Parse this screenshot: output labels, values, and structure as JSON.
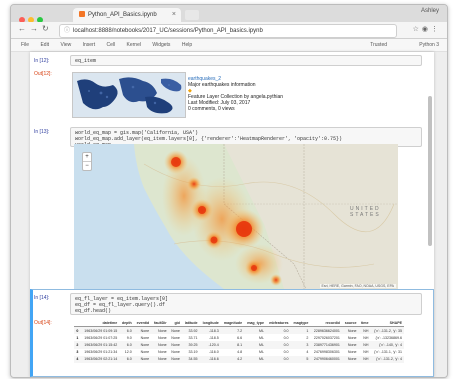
{
  "window": {
    "tab_title": "Python_API_Basics.ipynb",
    "profile_label": "Ashley"
  },
  "address_bar": {
    "url": "localhost:8888/notebooks/2017_UC/sessions/Python_API_basics.ipynb"
  },
  "notebook_menu": {
    "items": [
      "File",
      "Edit",
      "View",
      "Insert",
      "Cell",
      "Kernel",
      "Widgets",
      "Help"
    ],
    "kernel_status": "Trusted",
    "kernel_name": "Python 3"
  },
  "cells": {
    "cell1": {
      "in_prompt": "In [12]:",
      "code": "eq_item",
      "out_prompt": "Out[12]:",
      "item_title": "earthquakes_2",
      "item_desc": "Major earthquakes information",
      "item_type": "Feature Layer Collection by angela.pythian",
      "item_modified": "Last Modified: July 03, 2017",
      "item_comments": "0 comments, 0 views"
    },
    "cell2": {
      "in_prompt": "In [13]:",
      "code_lines": [
        "world_eq_map = gis.map('California, USA')",
        "world_eq_map.add_layer(eq_item.layers[0], {'renderer':'HeatmapRenderer', 'opacity':0.75})",
        "world_eq_map"
      ],
      "map_country_label_1": "UNITED",
      "map_country_label_2": "STATES",
      "map_attribution": "Esri, HERE, Garmin, FAO, NOAA, USGS, EPA"
    },
    "cell3": {
      "in_prompt": "In [14]:",
      "code_lines": [
        "eq_fl_layer = eq_item.layers[0]",
        "eq_df = eq_fl_layer.query().df",
        "eq_df.head()"
      ],
      "out_prompt": "Out[14]:"
    }
  },
  "table": {
    "columns": [
      "",
      "datetime",
      "depth",
      "eventid",
      "faultDir",
      "gid",
      "latitude",
      "longitude",
      "magnitude",
      "mag_type",
      "mbfeatures",
      "magtype",
      "recordid",
      "source",
      "time",
      "SHAPE"
    ],
    "rows": [
      [
        "0",
        "1963/06/29 01:09:15",
        "6.0",
        "None",
        "None",
        "None",
        "33.92",
        "-118.3",
        "7.2",
        "ML",
        "0.0",
        "1",
        "2289636624001",
        "None",
        "NH",
        "{'x': -131.2, 'y': 35"
      ],
      [
        "1",
        "1963/06/29 01:07:25",
        "9.0",
        "None",
        "None",
        "None",
        "33.71",
        "-118.5",
        "6.6",
        "ML",
        "0.0",
        "2",
        "2297026037201",
        "None",
        "NH",
        "{'x': -13236869.6"
      ],
      [
        "2",
        "1963/06/29 01:15:42",
        "6.0",
        "None",
        "None",
        "None",
        "39.25",
        "-120.4",
        "8.1",
        "ML",
        "0.0",
        "3",
        "2389771436901",
        "None",
        "NH",
        "{'x': -140, 'y': 4"
      ],
      [
        "3",
        "1963/06/29 01:21:34",
        "12.0",
        "None",
        "None",
        "None",
        "33.19",
        "-116.0",
        "4.8",
        "ML",
        "0.0",
        "4",
        "2476998306301",
        "None",
        "NH",
        "{'x': -131.1, 'y': 31"
      ],
      [
        "4",
        "1963/06/29 02:21:14",
        "6.0",
        "None",
        "None",
        "None",
        "34.55",
        "-116.6",
        "4.2",
        "ML",
        "0.0",
        "5",
        "2479906460001",
        "None",
        "NH",
        "{'x': -131.2, 'y': 4"
      ]
    ]
  },
  "colors": {
    "accent": "#42a5f5",
    "heat_core": "#e8380d",
    "heat_mid": "#f58a2a",
    "heat_outer": "#f7c267",
    "in_prompt": "#303f9f",
    "out_prompt": "#d84315"
  }
}
